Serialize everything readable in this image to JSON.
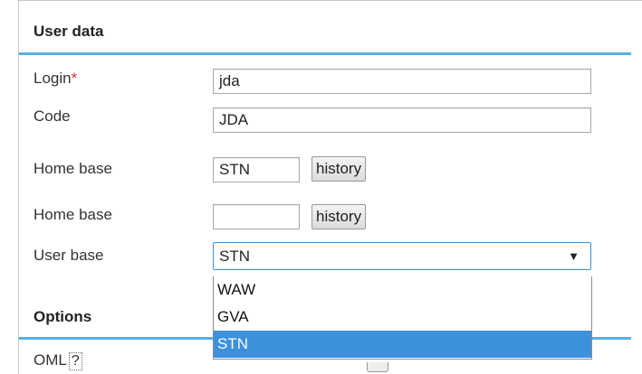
{
  "user_data": {
    "title": "User data",
    "login": {
      "label": "Login",
      "required_mark": "*",
      "value": "jda"
    },
    "code": {
      "label": "Code",
      "value": "JDA"
    },
    "home_base_1": {
      "label": "Home base",
      "value": "STN",
      "button": "history"
    },
    "home_base_2": {
      "label": "Home base",
      "value": "",
      "button": "history"
    },
    "user_base": {
      "label": "User base",
      "selected": "STN",
      "options": [
        "WAW",
        "GVA",
        "STN"
      ],
      "highlighted_index": 2
    }
  },
  "options": {
    "title": "Options",
    "oml": {
      "label": "OML",
      "help": "?"
    }
  },
  "colors": {
    "accent_rule": "#5aaee0",
    "selection": "#3d91dc",
    "required": "#e03030"
  }
}
